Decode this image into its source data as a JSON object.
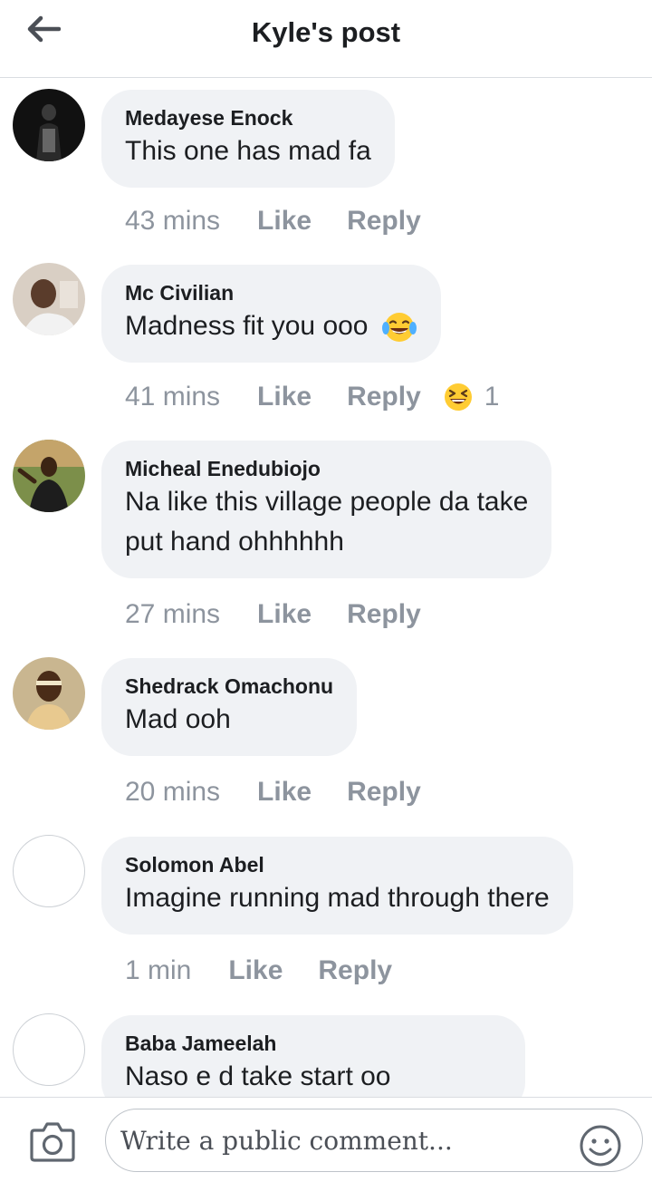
{
  "header": {
    "title": "Kyle's post",
    "back_icon": "arrow-left-icon"
  },
  "comments": [
    {
      "author": "Medayese Enock",
      "text_lines": [
        "This one has mad fa"
      ],
      "time": "43 mins",
      "like_label": "Like",
      "reply_label": "Reply"
    },
    {
      "author": "Mc Civilian",
      "text_lines": [
        "Madness fit you ooo"
      ],
      "text_emoji": "tears-of-joy-emoji",
      "time": "41 mins",
      "like_label": "Like",
      "reply_label": "Reply",
      "reaction_icon": "laughing-squint-emoji",
      "reaction_count": "1"
    },
    {
      "author": "Micheal Enedubiojo",
      "text_lines": [
        "Na like this village people da take",
        "put hand ohhhhhh"
      ],
      "time": "27 mins",
      "like_label": "Like",
      "reply_label": "Reply"
    },
    {
      "author": "Shedrack Omachonu",
      "text_lines": [
        "Mad ooh"
      ],
      "time": "20 mins",
      "like_label": "Like",
      "reply_label": "Reply"
    },
    {
      "author": "Solomon Abel",
      "text_lines": [
        "Imagine running mad through there"
      ],
      "time": "1 min",
      "like_label": "Like",
      "reply_label": "Reply"
    },
    {
      "author": "Baba Jameelah",
      "text_lines": [
        "Naso e d take start oo"
      ]
    }
  ],
  "composer": {
    "placeholder": "Write a public comment...",
    "camera_icon": "camera-icon",
    "emoji_icon": "smiley-icon"
  },
  "colors": {
    "bubble": "#f0f2f5",
    "meta_text": "#8d949e",
    "text": "#1c1e21"
  }
}
